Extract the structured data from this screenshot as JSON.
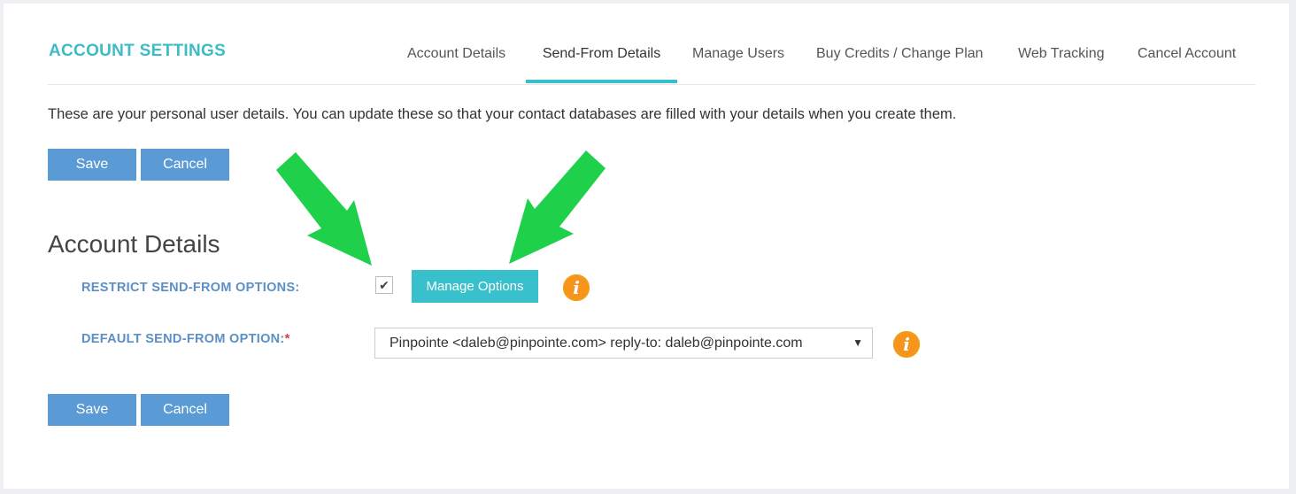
{
  "header": {
    "title": "ACCOUNT SETTINGS"
  },
  "tabs": [
    {
      "label": "Account Details",
      "active": false
    },
    {
      "label": "Send-From Details",
      "active": true
    },
    {
      "label": "Manage Users",
      "active": false
    },
    {
      "label": "Buy Credits / Change Plan",
      "active": false
    },
    {
      "label": "Web Tracking",
      "active": false
    },
    {
      "label": "Cancel Account",
      "active": false
    }
  ],
  "intro_text": "These are your personal user details. You can update these so that your contact databases are filled with your details when you create them.",
  "buttons": {
    "save": "Save",
    "cancel": "Cancel"
  },
  "section": {
    "title": "Account Details",
    "restrict_label": "RESTRICT SEND-FROM OPTIONS:",
    "restrict_checked": true,
    "check_glyph": "✔",
    "manage_options_label": "Manage Options",
    "default_label": "DEFAULT SEND-FROM OPTION:",
    "required_marker": "*",
    "default_value": "Pinpointe <daleb@pinpointe.com> reply-to: daleb@pinpointe.com",
    "caret_glyph": "▼",
    "info_glyph": "i"
  },
  "colors": {
    "accent": "#35c0cc",
    "button": "#5b9bd5",
    "label": "#5b8fc6",
    "info": "#f7941d",
    "arrow": "#1ed04a"
  },
  "icons": [
    "check-icon",
    "info-icon",
    "chevron-down-icon",
    "green-arrow"
  ]
}
